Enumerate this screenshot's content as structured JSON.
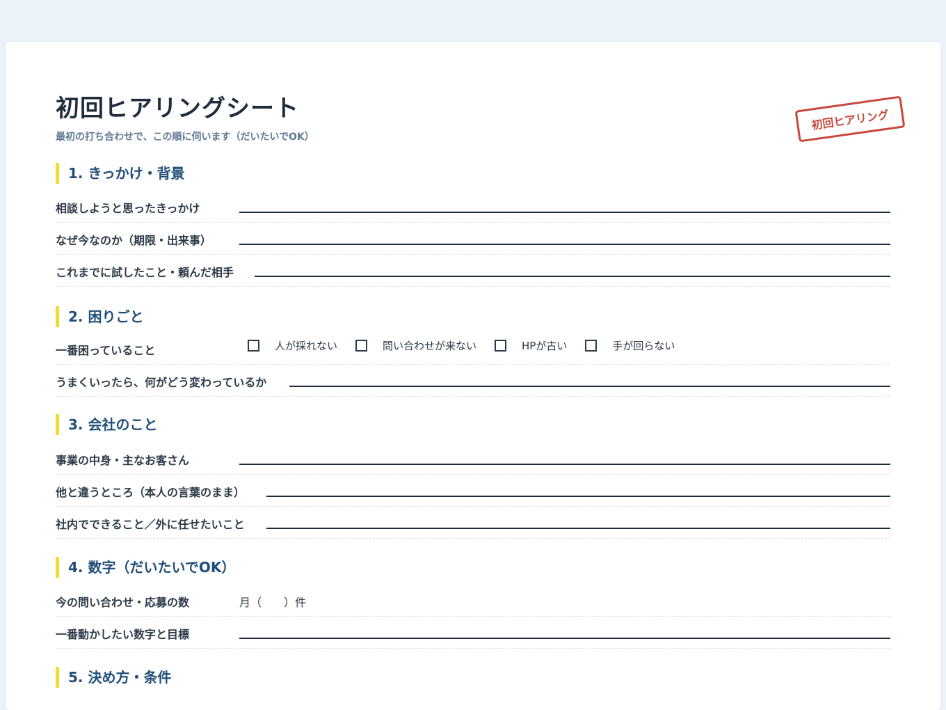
{
  "header": {
    "title": "初回ヒアリングシート",
    "subtitle": "最初の打ち合わせで、この順に伺います（だいたいでOK）",
    "stamp": "初回ヒアリング"
  },
  "colors": {
    "accent_bar": "#f0dc2e",
    "section_title": "#1f4e79",
    "stamp": "#c9473c",
    "background": "#ecf3fa"
  },
  "sections": {
    "s1": {
      "title": "1. きっかけ・背景",
      "rows": [
        "相談しようと思ったきっかけ",
        "なぜ今なのか（期限・出来事）",
        "これまでに試したこと・頼んだ相手"
      ]
    },
    "s2": {
      "title": "2. 困りごと",
      "trouble_label": "一番困っていること",
      "options": [
        "人が採れない",
        "問い合わせが来ない",
        "HPが古い",
        "手が回らない"
      ],
      "rows": [
        "うまくいったら、何がどう変わっているか"
      ]
    },
    "s3": {
      "title": "3. 会社のこと",
      "rows": [
        "事業の中身・主なお客さん",
        "他と違うところ（本人の言葉のまま）",
        "社内でできること／外に任せたいこと"
      ]
    },
    "s4": {
      "title": "4. 数字（だいたいでOK）",
      "count_label": "今の問い合わせ・応募の数",
      "count_text": "月（　　）件",
      "rows": [
        "一番動かしたい数字と目標"
      ]
    },
    "s5": {
      "title": "5. 決め方・条件"
    }
  }
}
